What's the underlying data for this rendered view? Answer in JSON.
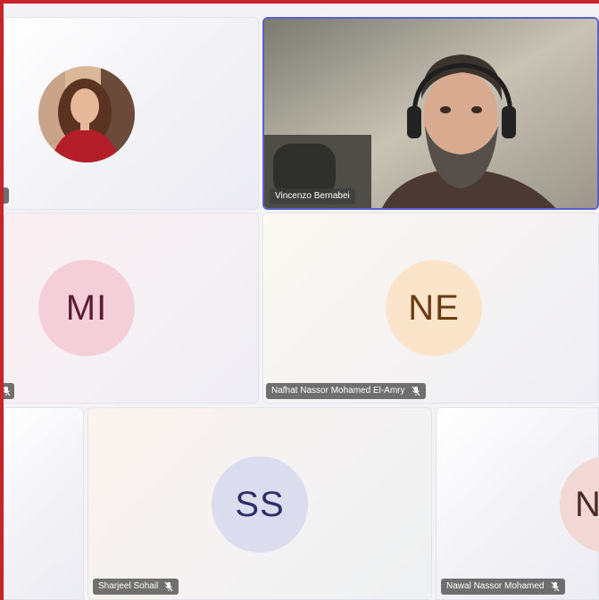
{
  "app": "Video meeting gallery",
  "accent_color": "#5b5fc7",
  "frame_color": "#c8242a",
  "participants": [
    {
      "name": "",
      "display": "photo",
      "muted": false
    },
    {
      "name": "Vincenzo Bernabei",
      "display": "video",
      "speaking": true
    },
    {
      "name": "",
      "initials": "MI",
      "muted": true
    },
    {
      "name": "Nafhat Nassor Mohamed El-Amry",
      "initials": "NE",
      "muted": true
    },
    {
      "name": "Sharjeel Sohail",
      "initials": "SS",
      "muted": true
    },
    {
      "name": "Nawal Nassor Mohamed",
      "initials": "N",
      "muted": true
    }
  ],
  "icons": {
    "mic_off": "mic-off-icon"
  }
}
